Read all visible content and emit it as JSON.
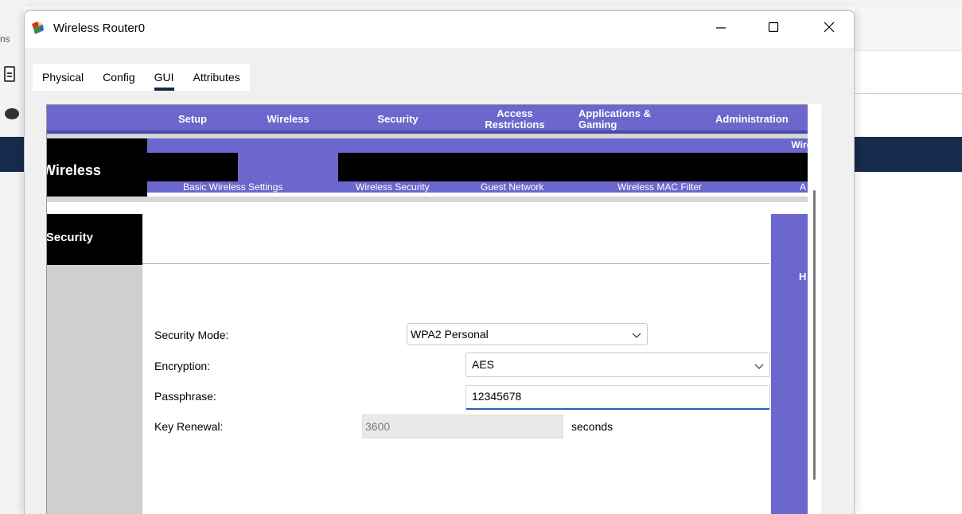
{
  "background": {
    "left_text": "ns"
  },
  "window": {
    "title": "Wireless Router0",
    "controls": {
      "minimize": "—",
      "maximize": "□",
      "close": "✕"
    }
  },
  "tabs": [
    {
      "label": "Physical",
      "active": false
    },
    {
      "label": "Config",
      "active": false
    },
    {
      "label": "GUI",
      "active": true
    },
    {
      "label": "Attributes",
      "active": false
    }
  ],
  "router_page": {
    "brand_text": "Wireless-N Broadband Router",
    "left_section_title": "Wireless",
    "menu": [
      {
        "label": "Setup"
      },
      {
        "label": "Wireless",
        "active": true
      },
      {
        "label": "Security"
      },
      {
        "label": "Access Restrictions"
      },
      {
        "label": "Applications & Gaming"
      },
      {
        "label": "Administration"
      }
    ],
    "submenu": [
      {
        "label": "Basic Wireless Settings"
      },
      {
        "label": "Wireless Security",
        "active": true
      },
      {
        "label": "Guest Network"
      },
      {
        "label": "Wireless MAC Filter"
      },
      {
        "label": "A"
      }
    ],
    "section_title": "Wireless Security",
    "help_letter": "H",
    "form": {
      "security_mode": {
        "label": "Security Mode:",
        "value": "WPA2 Personal"
      },
      "encryption": {
        "label": "Encryption:",
        "value": "AES"
      },
      "passphrase": {
        "label": "Passphrase:",
        "value": "12345678"
      },
      "key_renewal": {
        "label": "Key Renewal:",
        "value": "3600",
        "unit": "seconds"
      }
    }
  },
  "colors": {
    "router_purple": "#6b67cc",
    "router_black": "#000000",
    "tab_underline": "#0f2a4a",
    "input_focus": "#2463b3",
    "bg_navy": "#172b4d"
  }
}
